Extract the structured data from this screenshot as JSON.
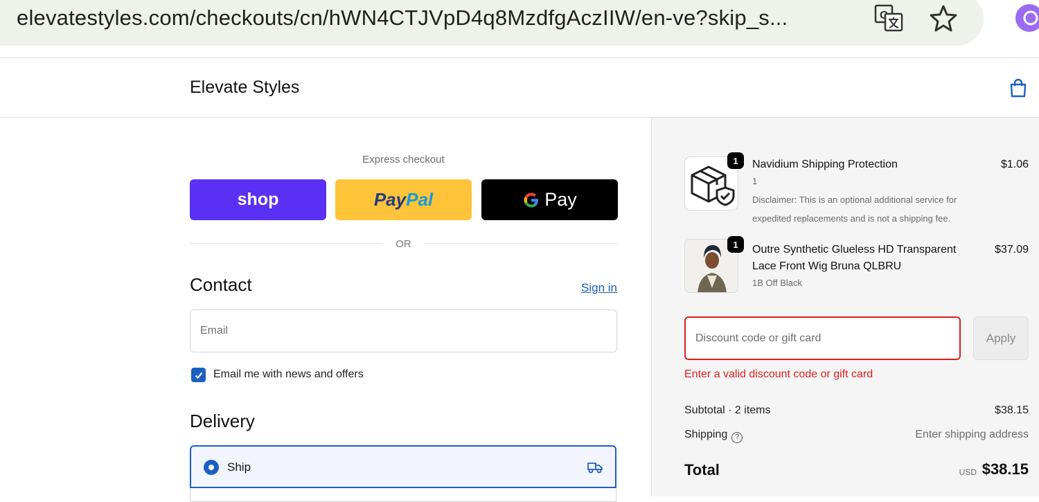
{
  "browser": {
    "url": "elevatestyles.com/checkouts/cn/hWN4CTJVpD4q8MzdfgAczIIW/en-ve?skip_s..."
  },
  "header": {
    "store_name": "Elevate Styles"
  },
  "express_checkout": {
    "label": "Express checkout",
    "shop_label": "shop",
    "paypal_label_1": "Pay",
    "paypal_label_2": "Pal",
    "gpay_g": "G",
    "gpay_label": "Pay",
    "divider_text": "OR"
  },
  "contact": {
    "title": "Contact",
    "sign_in": "Sign in",
    "email_placeholder": "Email",
    "newsletter_label": "Email me with news and offers",
    "newsletter_checked": true
  },
  "delivery": {
    "title": "Delivery",
    "selected_option": "Ship"
  },
  "order_summary": {
    "items": [
      {
        "name": "Navidium Shipping Protection",
        "quantity": "1",
        "variant": "1",
        "note": "Disclaimer: This is an optional additional service for expedited replacements and is not a shipping fee.",
        "price": "$1.06"
      },
      {
        "name": "Outre Synthetic Glueless HD Transparent Lace Front Wig Bruna QLBRU",
        "quantity": "1",
        "variant": "1B Off Black",
        "price": "$37.09"
      }
    ],
    "discount_placeholder": "Discount code or gift card",
    "apply_label": "Apply",
    "discount_error": "Enter a valid discount code or gift card",
    "subtotal_label": "Subtotal · 2 items",
    "subtotal_value": "$38.15",
    "shipping_label": "Shipping",
    "shipping_value": "Enter shipping address",
    "total_label": "Total",
    "total_currency": "USD",
    "total_value": "$38.15"
  },
  "colors": {
    "shop_purple": "#5a31f4",
    "paypal_yellow": "#ffc439",
    "accent_blue": "#1c5fc4",
    "error_red": "#dd1d1d"
  },
  "icons": [
    "translate-icon",
    "star-icon",
    "extension-icon",
    "shopping-bag-icon",
    "truck-icon",
    "help-circle-icon",
    "package-shield-icon",
    "check-icon"
  ]
}
